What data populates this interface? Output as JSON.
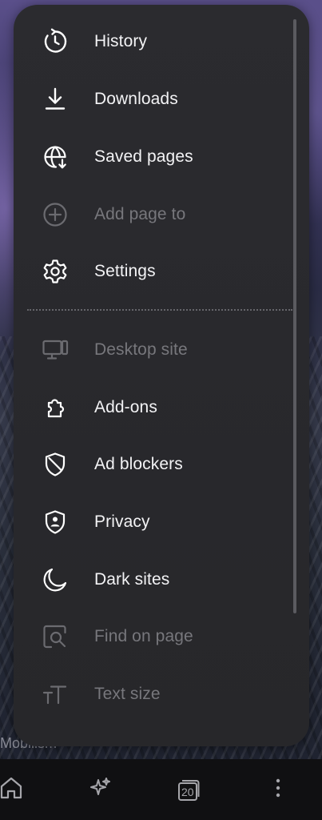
{
  "menu": {
    "items": [
      {
        "label": "History",
        "icon": "history-icon",
        "enabled": true
      },
      {
        "label": "Downloads",
        "icon": "download-icon",
        "enabled": true
      },
      {
        "label": "Saved pages",
        "icon": "saved-pages-icon",
        "enabled": true
      },
      {
        "label": "Add page to",
        "icon": "plus-circle-icon",
        "enabled": false
      },
      {
        "label": "Settings",
        "icon": "gear-icon",
        "enabled": true
      },
      {
        "label": "Desktop site",
        "icon": "desktop-icon",
        "enabled": false
      },
      {
        "label": "Add-ons",
        "icon": "puzzle-icon",
        "enabled": true
      },
      {
        "label": "Ad blockers",
        "icon": "shield-slash-icon",
        "enabled": true
      },
      {
        "label": "Privacy",
        "icon": "privacy-shield-icon",
        "enabled": true
      },
      {
        "label": "Dark sites",
        "icon": "moon-icon",
        "enabled": true
      },
      {
        "label": "Find on page",
        "icon": "find-icon",
        "enabled": false
      },
      {
        "label": "Text size",
        "icon": "text-size-icon",
        "enabled": false
      }
    ]
  },
  "background": {
    "partial_text": "Mobilism"
  },
  "bottom_nav": {
    "tabs_count": "20",
    "items": [
      "home-icon",
      "sparkle-icon",
      "tabs-icon",
      "more-vertical-icon"
    ]
  },
  "colors": {
    "menu_bg": "#2b2b2f",
    "text_enabled": "#f3f3f5",
    "text_disabled": "#77777c",
    "icon_enabled": "#ffffff",
    "icon_disabled": "#6b6b70"
  }
}
